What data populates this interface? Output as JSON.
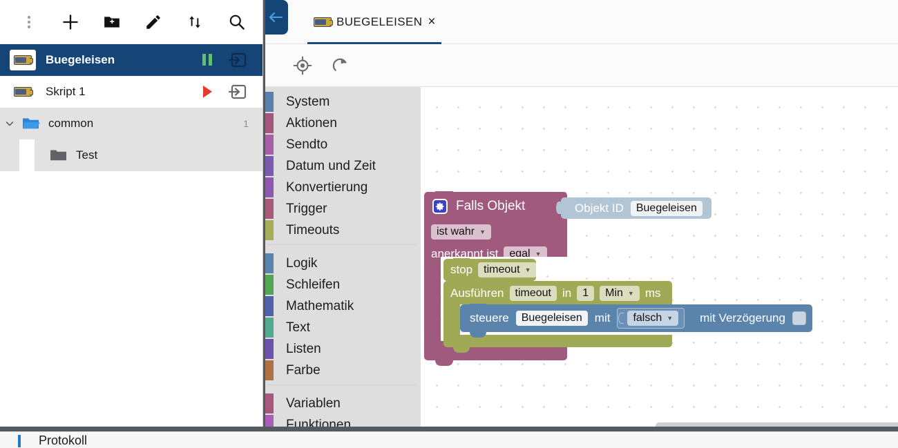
{
  "sidebar": {
    "toolbar": [
      {
        "name": "more-menu-button",
        "icon": "kebab-menu-icon",
        "label": ""
      },
      {
        "name": "add-script-button",
        "icon": "plus-icon",
        "label": ""
      },
      {
        "name": "add-folder-button",
        "icon": "folder-plus-icon",
        "label": ""
      },
      {
        "name": "rename-button",
        "icon": "pencil-icon",
        "label": ""
      },
      {
        "name": "expand-collapse-button",
        "icon": "sort-arrows-icon",
        "label": ""
      },
      {
        "name": "search-button",
        "icon": "search-icon",
        "label": ""
      }
    ],
    "tree": [
      {
        "label": "Buegeleisen",
        "icon": "blockly-script-icon",
        "selected": true,
        "state_icon": "pause-icon",
        "export_icon": "export-icon",
        "count": ""
      },
      {
        "label": "Skript 1",
        "icon": "blockly-script-icon",
        "selected": false,
        "state_icon": "play-icon",
        "export_icon": "export-icon",
        "count": ""
      },
      {
        "label": "common",
        "icon": "folder-open-icon",
        "selected": false,
        "count": "1",
        "expander": "chevron-down-icon"
      },
      {
        "label": "Test",
        "icon": "folder-icon",
        "selected": false,
        "count": ""
      }
    ]
  },
  "editor": {
    "back_button_icon": "arrow-left-icon",
    "tab": {
      "label": "BUEGELEISEN",
      "icon": "blockly-script-icon",
      "close": "×"
    },
    "toolbar": [
      {
        "name": "center-blocks-button",
        "icon": "crosshair-target-icon"
      },
      {
        "name": "reload-button",
        "icon": "refresh-icon"
      }
    ]
  },
  "toolbox": {
    "categories": [
      {
        "label": "System",
        "color": "#5b80ab"
      },
      {
        "label": "Aktionen",
        "color": "#a4577a"
      },
      {
        "label": "Sendto",
        "color": "#a85fa8"
      },
      {
        "label": "Datum und Zeit",
        "color": "#7b5bb0"
      },
      {
        "label": "Konvertierung",
        "color": "#8f59b0"
      },
      {
        "label": "Trigger",
        "color": "#a85b77"
      },
      {
        "label": "Timeouts",
        "color": "#a5ad58"
      },
      {
        "separator": true
      },
      {
        "label": "Logik",
        "color": "#5b84ad"
      },
      {
        "label": "Schleifen",
        "color": "#54a653"
      },
      {
        "label": "Mathematik",
        "color": "#5160ab"
      },
      {
        "label": "Text",
        "color": "#54a991"
      },
      {
        "label": "Listen",
        "color": "#6b52ab"
      },
      {
        "label": "Farbe",
        "color": "#ae7245"
      },
      {
        "separator": true
      },
      {
        "label": "Variablen",
        "color": "#a8577d"
      },
      {
        "label": "Funktionen",
        "color": "#a85fb5"
      }
    ]
  },
  "blocks": {
    "if_object": {
      "title": "Falls Objekt",
      "mutator_icon": "gear-icon",
      "condition_label": "ist wahr",
      "ack_label": "anerkannt ist",
      "ack_value": "egal",
      "color": "#a05a7d"
    },
    "object_id": {
      "label": "Objekt ID",
      "value": "Buegeleisen",
      "color": "#b2c5d4"
    },
    "stop_timeout": {
      "label": "stop",
      "value": "timeout",
      "color": "#a0a955"
    },
    "exec_timeout": {
      "label": "Ausführen",
      "name_value": "timeout",
      "in_label": "in",
      "delay_value": "1",
      "unit_value": "Min",
      "unit_suffix": "ms",
      "color": "#a0a955"
    },
    "control": {
      "label": "steuere",
      "object_value": "Buegeleisen",
      "with_label": "mit",
      "value": "falsch",
      "delay_label": "mit Verzögerung",
      "delay_checked": false,
      "color": "#5b84ad"
    }
  },
  "bottom": {
    "log_label": "Protokoll"
  },
  "colors": {
    "selected_row": "#154577",
    "group_row": "#e2e2e2",
    "tab_underline": "#1b4a7c",
    "play_icon": "#e8392f",
    "pause_icon": "#5fc26a",
    "toolbox_bg": "#dedede",
    "divider": "#555a5e"
  }
}
